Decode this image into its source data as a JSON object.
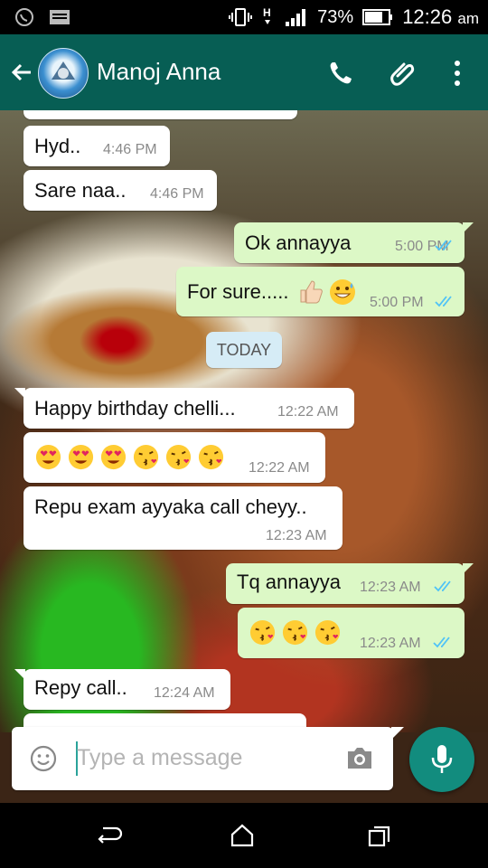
{
  "status_bar": {
    "battery": "73%",
    "time": "12:26",
    "ampm": "am"
  },
  "header": {
    "contact_name": "Manoj Anna",
    "back_icon": "arrow-left-icon",
    "call_icon": "phone-icon",
    "attach_icon": "paperclip-icon",
    "menu_icon": "more-vert-icon"
  },
  "messages": [
    {
      "dir": "in",
      "text": "Hyd..",
      "time": "4:46 PM"
    },
    {
      "dir": "in",
      "text": "Sare naa..",
      "time": "4:46 PM"
    },
    {
      "dir": "out",
      "text": "Ok annayya",
      "time": "5:00 PM"
    },
    {
      "dir": "out",
      "text": "For sure.....",
      "time": "5:00 PM"
    },
    {
      "dir": "in",
      "text": "Happy birthday chelli...",
      "time": "12:22 AM"
    },
    {
      "dir": "in",
      "text": "",
      "time": "12:22 AM"
    },
    {
      "dir": "in",
      "text": "Repu exam ayyaka call cheyy..",
      "time": "12:23 AM"
    },
    {
      "dir": "out",
      "text": "Tq annayya",
      "time": "12:23 AM"
    },
    {
      "dir": "out",
      "text": "",
      "time": "12:23 AM"
    },
    {
      "dir": "in",
      "text": "Repy call..",
      "time": "12:24 AM"
    }
  ],
  "date_divider": "TODAY",
  "composer": {
    "placeholder": "Type a message",
    "emoji_icon": "smiley-icon",
    "camera_icon": "camera-icon",
    "mic_icon": "mic-icon"
  },
  "colors": {
    "header": "#075e54",
    "outgoing": "#dcf8c6",
    "incoming": "#ffffff",
    "ticks": "#4fc3f7",
    "mic": "#128c7e"
  }
}
